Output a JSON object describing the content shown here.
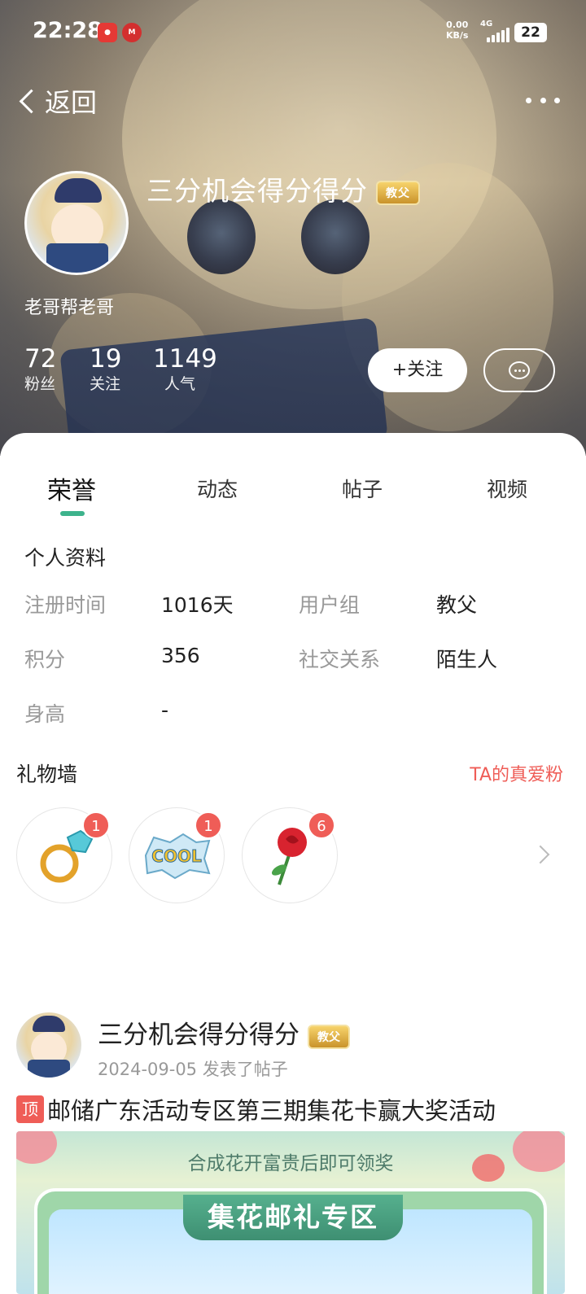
{
  "status_bar": {
    "time": "22:28",
    "net_speed_value": "0.00",
    "net_speed_unit": "KB/s",
    "network": "4G",
    "battery": "22"
  },
  "nav": {
    "back_label": "返回"
  },
  "profile": {
    "username": "三分机会得分得分",
    "badge": "教父",
    "signature": "老哥帮老哥",
    "stats": [
      {
        "num": "72",
        "label": "粉丝"
      },
      {
        "num": "19",
        "label": "关注"
      },
      {
        "num": "1149",
        "label": "人气"
      }
    ],
    "follow_label": "+关注"
  },
  "tabs": [
    {
      "label": "荣誉",
      "active": true
    },
    {
      "label": "动态"
    },
    {
      "label": "帖子"
    },
    {
      "label": "视频"
    }
  ],
  "info": {
    "title": "个人资料",
    "rows": [
      {
        "l1": "注册时间",
        "v1": "1016天",
        "l2": "用户组",
        "v2": "教父"
      },
      {
        "l1": "积分",
        "v1": "356",
        "l2": "社交关系",
        "v2": "陌生人"
      },
      {
        "l1": "身高",
        "v1": "-"
      }
    ]
  },
  "gifts": {
    "title": "礼物墙",
    "fans_link": "TA的真爱粉",
    "items": [
      {
        "icon": "ring-icon",
        "count": "1"
      },
      {
        "icon": "cool-sticker-icon",
        "count": "1"
      },
      {
        "icon": "rose-icon",
        "count": "6"
      }
    ]
  },
  "post": {
    "username": "三分机会得分得分",
    "badge": "教父",
    "date": "2024-09-05",
    "action": "发表了帖子",
    "top_tag": "顶",
    "title": "邮储广东活动专区第三期集花卡赢大奖活动",
    "image_caption": "合成花开富贵后即可领奖",
    "image_heading": "集花邮礼专区"
  },
  "colors": {
    "accent": "#3db38c",
    "red": "#ef5d57",
    "badge_gold": "#d9a63c"
  }
}
